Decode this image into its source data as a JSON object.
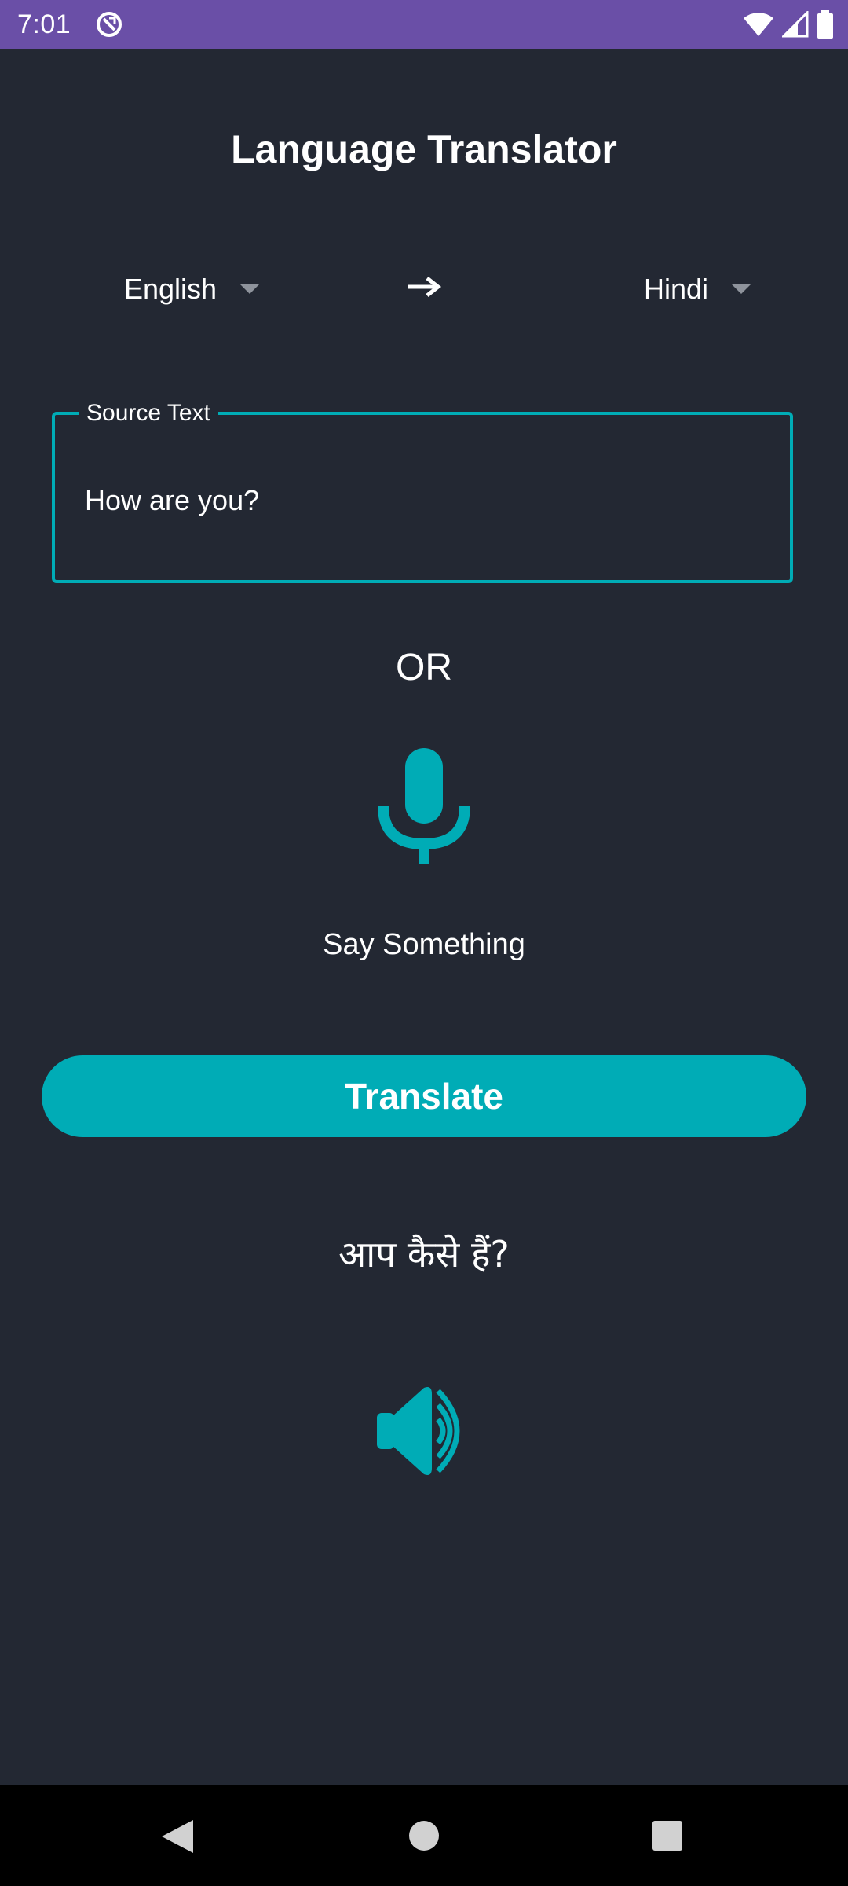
{
  "status_bar": {
    "time": "7:01",
    "icons": [
      "sync-off-icon",
      "wifi-icon",
      "cell-signal-icon",
      "battery-icon"
    ]
  },
  "header": {
    "title": "Language Translator"
  },
  "languages": {
    "source": "English",
    "target": "Hindi",
    "arrow_icon": "arrow-right-icon"
  },
  "source_field": {
    "label": "Source Text",
    "value": "How are you?"
  },
  "or_label": "OR",
  "mic": {
    "icon": "microphone-icon",
    "prompt": "Say Something"
  },
  "translate_button": {
    "label": "Translate"
  },
  "result": {
    "text": "आप कैसे हैं?",
    "speaker_icon": "speaker-icon"
  },
  "nav_bar": {
    "icons": [
      "back-icon",
      "home-icon",
      "recents-icon"
    ]
  },
  "colors": {
    "status_bar": "#6a4fa7",
    "background": "#232833",
    "accent": "#00acb6",
    "nav_bar": "#000000"
  }
}
